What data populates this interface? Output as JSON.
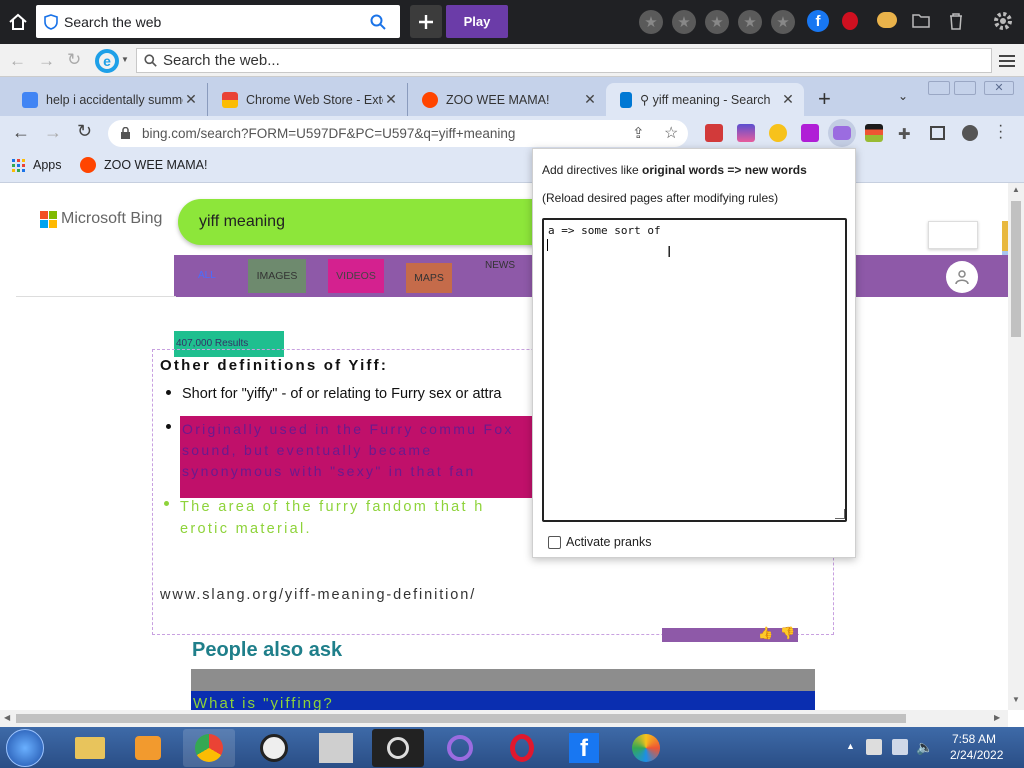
{
  "outer_bar": {
    "search_label": "Search the web",
    "play_label": "Play"
  },
  "ie_bar": {
    "address_placeholder": "Search the web..."
  },
  "tabs": [
    {
      "title": "help i accidentally summo",
      "icon": "google-favicon",
      "color": "#4285f4"
    },
    {
      "title": "Chrome Web Store - Exte",
      "icon": "chrome-webstore-favicon",
      "color": "#e94235"
    },
    {
      "title": "ZOO WEE MAMA!",
      "icon": "reddit-favicon",
      "color": "#ff4500"
    },
    {
      "title": "⚲ yiff meaning - Search",
      "icon": "bing-favicon",
      "color": "#0078d4",
      "active": true
    }
  ],
  "toolbar": {
    "url": "bing.com/search?FORM=U597DF&PC=U597&q=yiff+meaning"
  },
  "bookmarks": [
    {
      "label": "Apps",
      "icon": "apps-grid-icon"
    },
    {
      "label": "ZOO WEE MAMA!",
      "icon": "reddit-favicon"
    }
  ],
  "page": {
    "brand": "Microsoft Bing",
    "query": "yiff meaning",
    "nav": [
      "ALL",
      "IMAGES",
      "VIDEOS",
      "MAPS",
      "NEWS"
    ],
    "results_count": "407,000 Results",
    "definitions_heading": "Other definitions of Yiff:",
    "bullets": [
      "Short for \"yiffy\" - of or relating to Furry sex or attra",
      "Originally used in the Furry commu Fox sound, but eventually became synonymous with \"sexy\" in that fan",
      "The area of the furry fandom that h erotic material."
    ],
    "source_url": "www.slang.org/yiff-meaning-definition/",
    "paa_heading": "People also ask",
    "paa_question": "What is \"yiffing?"
  },
  "popup": {
    "directive_prefix": "Add directives like ",
    "directive_bold": "original words => new words",
    "reload_note": "(Reload desired pages after modifying rules)",
    "rules_text": "a => some sort of\n",
    "checkbox_label": "Activate pranks",
    "checkbox_checked": false
  },
  "taskbar": {
    "time": "7:58 AM",
    "date": "2/24/2022",
    "apps": [
      "start-orb",
      "file-explorer-icon",
      "media-player-icon",
      "chrome-icon",
      "app-icon-face",
      "app-icon-photo",
      "quicktime-icon",
      "app-icon-q-purple",
      "opera-icon",
      "facebook-icon",
      "app-icon-colorful"
    ]
  },
  "colors": {
    "accent_play": "#6b3ca8",
    "search_green": "#8de63a",
    "nav_purple": "#8e59a8",
    "magenta_block": "#c0106a",
    "green_text": "#8ed33a",
    "teal_heading": "#1f7f8a",
    "paa_blue": "#0a2eb0"
  }
}
